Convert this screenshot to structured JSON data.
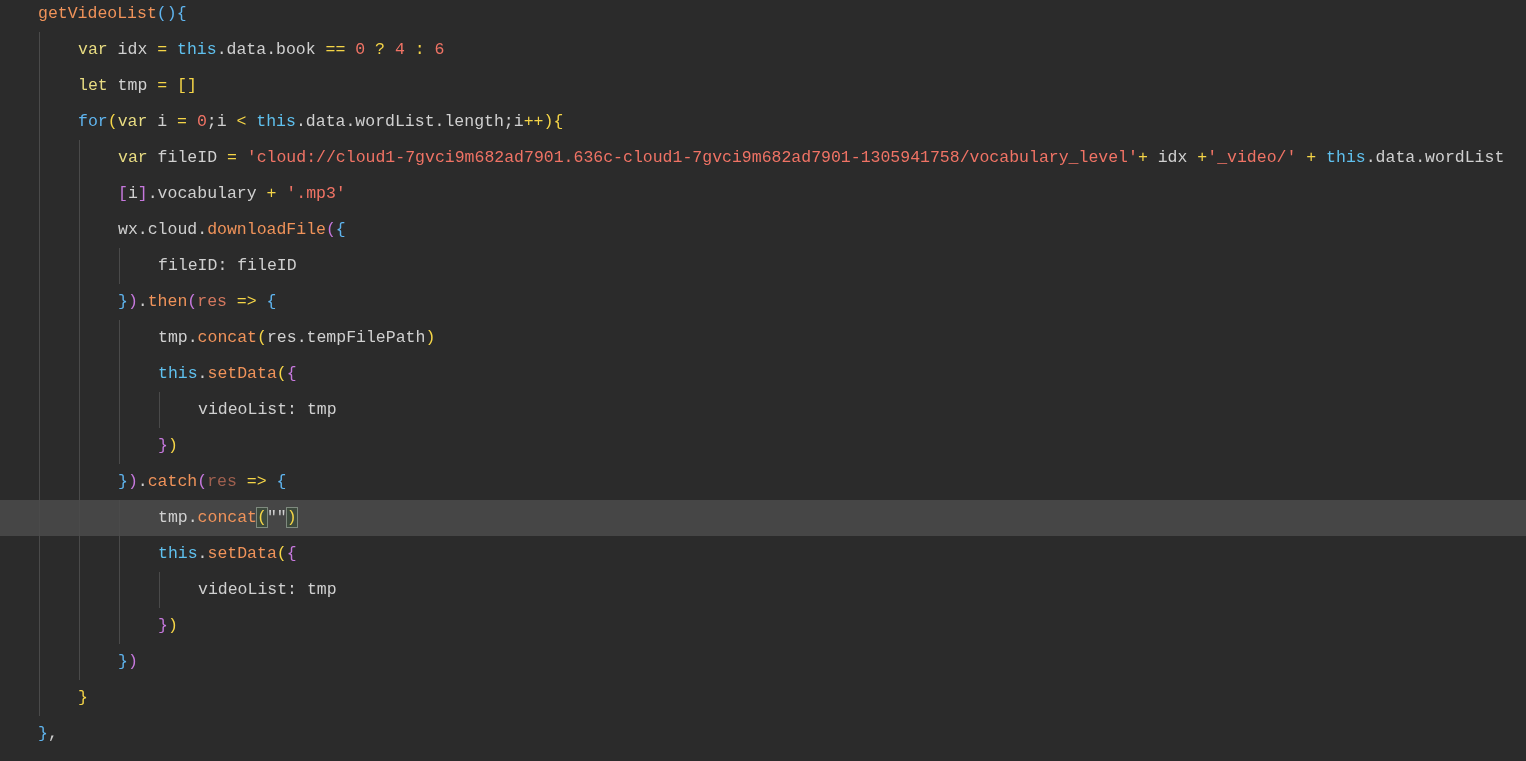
{
  "editor": {
    "lines": [
      {
        "current": false,
        "tokens": [
          {
            "text": "getVideoList",
            "kind": "fn"
          },
          {
            "text": "(){",
            "kind": "bb"
          }
        ],
        "children": [
          {
            "current": false,
            "tokens": [
              {
                "text": "var",
                "kind": "kw"
              },
              {
                "text": " idx ",
                "kind": "id"
              },
              {
                "text": "= ",
                "kind": "op"
              },
              {
                "text": "this",
                "kind": "this"
              },
              {
                "text": ".data.book ",
                "kind": "id"
              },
              {
                "text": "== ",
                "kind": "op"
              },
              {
                "text": "0 ",
                "kind": "num"
              },
              {
                "text": "? ",
                "kind": "op"
              },
              {
                "text": "4 ",
                "kind": "num"
              },
              {
                "text": ": ",
                "kind": "op"
              },
              {
                "text": "6",
                "kind": "num"
              }
            ]
          },
          {
            "current": false,
            "tokens": [
              {
                "text": "let",
                "kind": "kw"
              },
              {
                "text": " tmp ",
                "kind": "id"
              },
              {
                "text": "= ",
                "kind": "op"
              },
              {
                "text": "[]",
                "kind": "by"
              }
            ]
          },
          {
            "current": false,
            "tokens": [
              {
                "text": "for",
                "kind": "ctl"
              },
              {
                "text": "(",
                "kind": "by"
              },
              {
                "text": "var",
                "kind": "kw"
              },
              {
                "text": " i ",
                "kind": "id"
              },
              {
                "text": "= ",
                "kind": "op"
              },
              {
                "text": "0",
                "kind": "num"
              },
              {
                "text": ";i ",
                "kind": "id"
              },
              {
                "text": "< ",
                "kind": "op"
              },
              {
                "text": "this",
                "kind": "this"
              },
              {
                "text": ".data.wordList.length;i",
                "kind": "id"
              },
              {
                "text": "++",
                "kind": "op"
              },
              {
                "text": "){",
                "kind": "by"
              }
            ],
            "children": [
              {
                "current": false,
                "tokens": [
                  {
                    "text": "var",
                    "kind": "kw"
                  },
                  {
                    "text": " fileID ",
                    "kind": "id"
                  },
                  {
                    "text": "= ",
                    "kind": "op"
                  },
                  {
                    "text": "'cloud://cloud1-7gvci9m682ad7901.636c-cloud1-7gvci9m682ad7901-1305941758/vocabulary_level'",
                    "kind": "str"
                  },
                  {
                    "text": "+",
                    "kind": "op"
                  },
                  {
                    "text": " idx ",
                    "kind": "id"
                  },
                  {
                    "text": "+",
                    "kind": "op"
                  },
                  {
                    "text": "'_video/' ",
                    "kind": "str"
                  },
                  {
                    "text": "+ ",
                    "kind": "op"
                  },
                  {
                    "text": "this",
                    "kind": "this"
                  },
                  {
                    "text": ".data.wordList",
                    "kind": "id"
                  }
                ]
              },
              {
                "current": false,
                "tokens": [
                  {
                    "text": "[",
                    "kind": "bp"
                  },
                  {
                    "text": "i",
                    "kind": "id"
                  },
                  {
                    "text": "]",
                    "kind": "bp"
                  },
                  {
                    "text": ".vocabulary ",
                    "kind": "id"
                  },
                  {
                    "text": "+ ",
                    "kind": "op"
                  },
                  {
                    "text": "'.mp3'",
                    "kind": "str"
                  }
                ]
              },
              {
                "current": false,
                "tokens": [
                  {
                    "text": "wx.cloud.",
                    "kind": "id"
                  },
                  {
                    "text": "downloadFile",
                    "kind": "fn"
                  },
                  {
                    "text": "(",
                    "kind": "bp"
                  },
                  {
                    "text": "{",
                    "kind": "bb"
                  }
                ],
                "children": [
                  {
                    "current": false,
                    "tokens": [
                      {
                        "text": "fileID: fileID",
                        "kind": "id"
                      }
                    ]
                  }
                ]
              },
              {
                "current": false,
                "tokens": [
                  {
                    "text": "}",
                    "kind": "bb"
                  },
                  {
                    "text": ")",
                    "kind": "bp"
                  },
                  {
                    "text": ".",
                    "kind": "id"
                  },
                  {
                    "text": "then",
                    "kind": "fn"
                  },
                  {
                    "text": "(",
                    "kind": "bp"
                  },
                  {
                    "text": "res ",
                    "kind": "param"
                  },
                  {
                    "text": "=> ",
                    "kind": "op"
                  },
                  {
                    "text": "{",
                    "kind": "bb"
                  }
                ],
                "children": [
                  {
                    "current": false,
                    "tokens": [
                      {
                        "text": "tmp.",
                        "kind": "id"
                      },
                      {
                        "text": "concat",
                        "kind": "fn"
                      },
                      {
                        "text": "(",
                        "kind": "by"
                      },
                      {
                        "text": "res.tempFilePath",
                        "kind": "id"
                      },
                      {
                        "text": ")",
                        "kind": "by"
                      }
                    ]
                  },
                  {
                    "current": false,
                    "tokens": [
                      {
                        "text": "this",
                        "kind": "this"
                      },
                      {
                        "text": ".",
                        "kind": "id"
                      },
                      {
                        "text": "setData",
                        "kind": "fn"
                      },
                      {
                        "text": "(",
                        "kind": "by"
                      },
                      {
                        "text": "{",
                        "kind": "bp"
                      }
                    ],
                    "children": [
                      {
                        "current": false,
                        "tokens": [
                          {
                            "text": "videoList: tmp",
                            "kind": "id"
                          }
                        ]
                      }
                    ]
                  },
                  {
                    "current": false,
                    "tokens": [
                      {
                        "text": "}",
                        "kind": "bp"
                      },
                      {
                        "text": ")",
                        "kind": "by"
                      }
                    ]
                  }
                ]
              },
              {
                "current": false,
                "tokens": [
                  {
                    "text": "}",
                    "kind": "bb"
                  },
                  {
                    "text": ")",
                    "kind": "bp"
                  },
                  {
                    "text": ".",
                    "kind": "id"
                  },
                  {
                    "text": "catch",
                    "kind": "fn"
                  },
                  {
                    "text": "(",
                    "kind": "bp"
                  },
                  {
                    "text": "res ",
                    "kind": "param-dim"
                  },
                  {
                    "text": "=> ",
                    "kind": "op"
                  },
                  {
                    "text": "{",
                    "kind": "bb"
                  }
                ],
                "children": [
                  {
                    "current": true,
                    "tokens": [
                      {
                        "text": "tmp.",
                        "kind": "id"
                      },
                      {
                        "text": "concat",
                        "kind": "fn"
                      },
                      {
                        "text": "(",
                        "kind": "match"
                      },
                      {
                        "text": "\"\"",
                        "kind": "id"
                      },
                      {
                        "text": ")",
                        "kind": "match"
                      }
                    ]
                  },
                  {
                    "current": false,
                    "tokens": [
                      {
                        "text": "this",
                        "kind": "this"
                      },
                      {
                        "text": ".",
                        "kind": "id"
                      },
                      {
                        "text": "setData",
                        "kind": "fn"
                      },
                      {
                        "text": "(",
                        "kind": "by"
                      },
                      {
                        "text": "{",
                        "kind": "bp"
                      }
                    ],
                    "children": [
                      {
                        "current": false,
                        "tokens": [
                          {
                            "text": "videoList: tmp",
                            "kind": "id"
                          }
                        ]
                      }
                    ]
                  },
                  {
                    "current": false,
                    "tokens": [
                      {
                        "text": "}",
                        "kind": "bp"
                      },
                      {
                        "text": ")",
                        "kind": "by"
                      }
                    ]
                  }
                ]
              },
              {
                "current": false,
                "tokens": [
                  {
                    "text": "}",
                    "kind": "bb"
                  },
                  {
                    "text": ")",
                    "kind": "bp"
                  }
                ]
              }
            ]
          },
          {
            "current": false,
            "tokens": [
              {
                "text": "}",
                "kind": "by"
              }
            ]
          }
        ]
      },
      {
        "current": false,
        "tokens": [
          {
            "text": "}",
            "kind": "bb"
          },
          {
            "text": ",",
            "kind": "id"
          }
        ]
      }
    ]
  }
}
